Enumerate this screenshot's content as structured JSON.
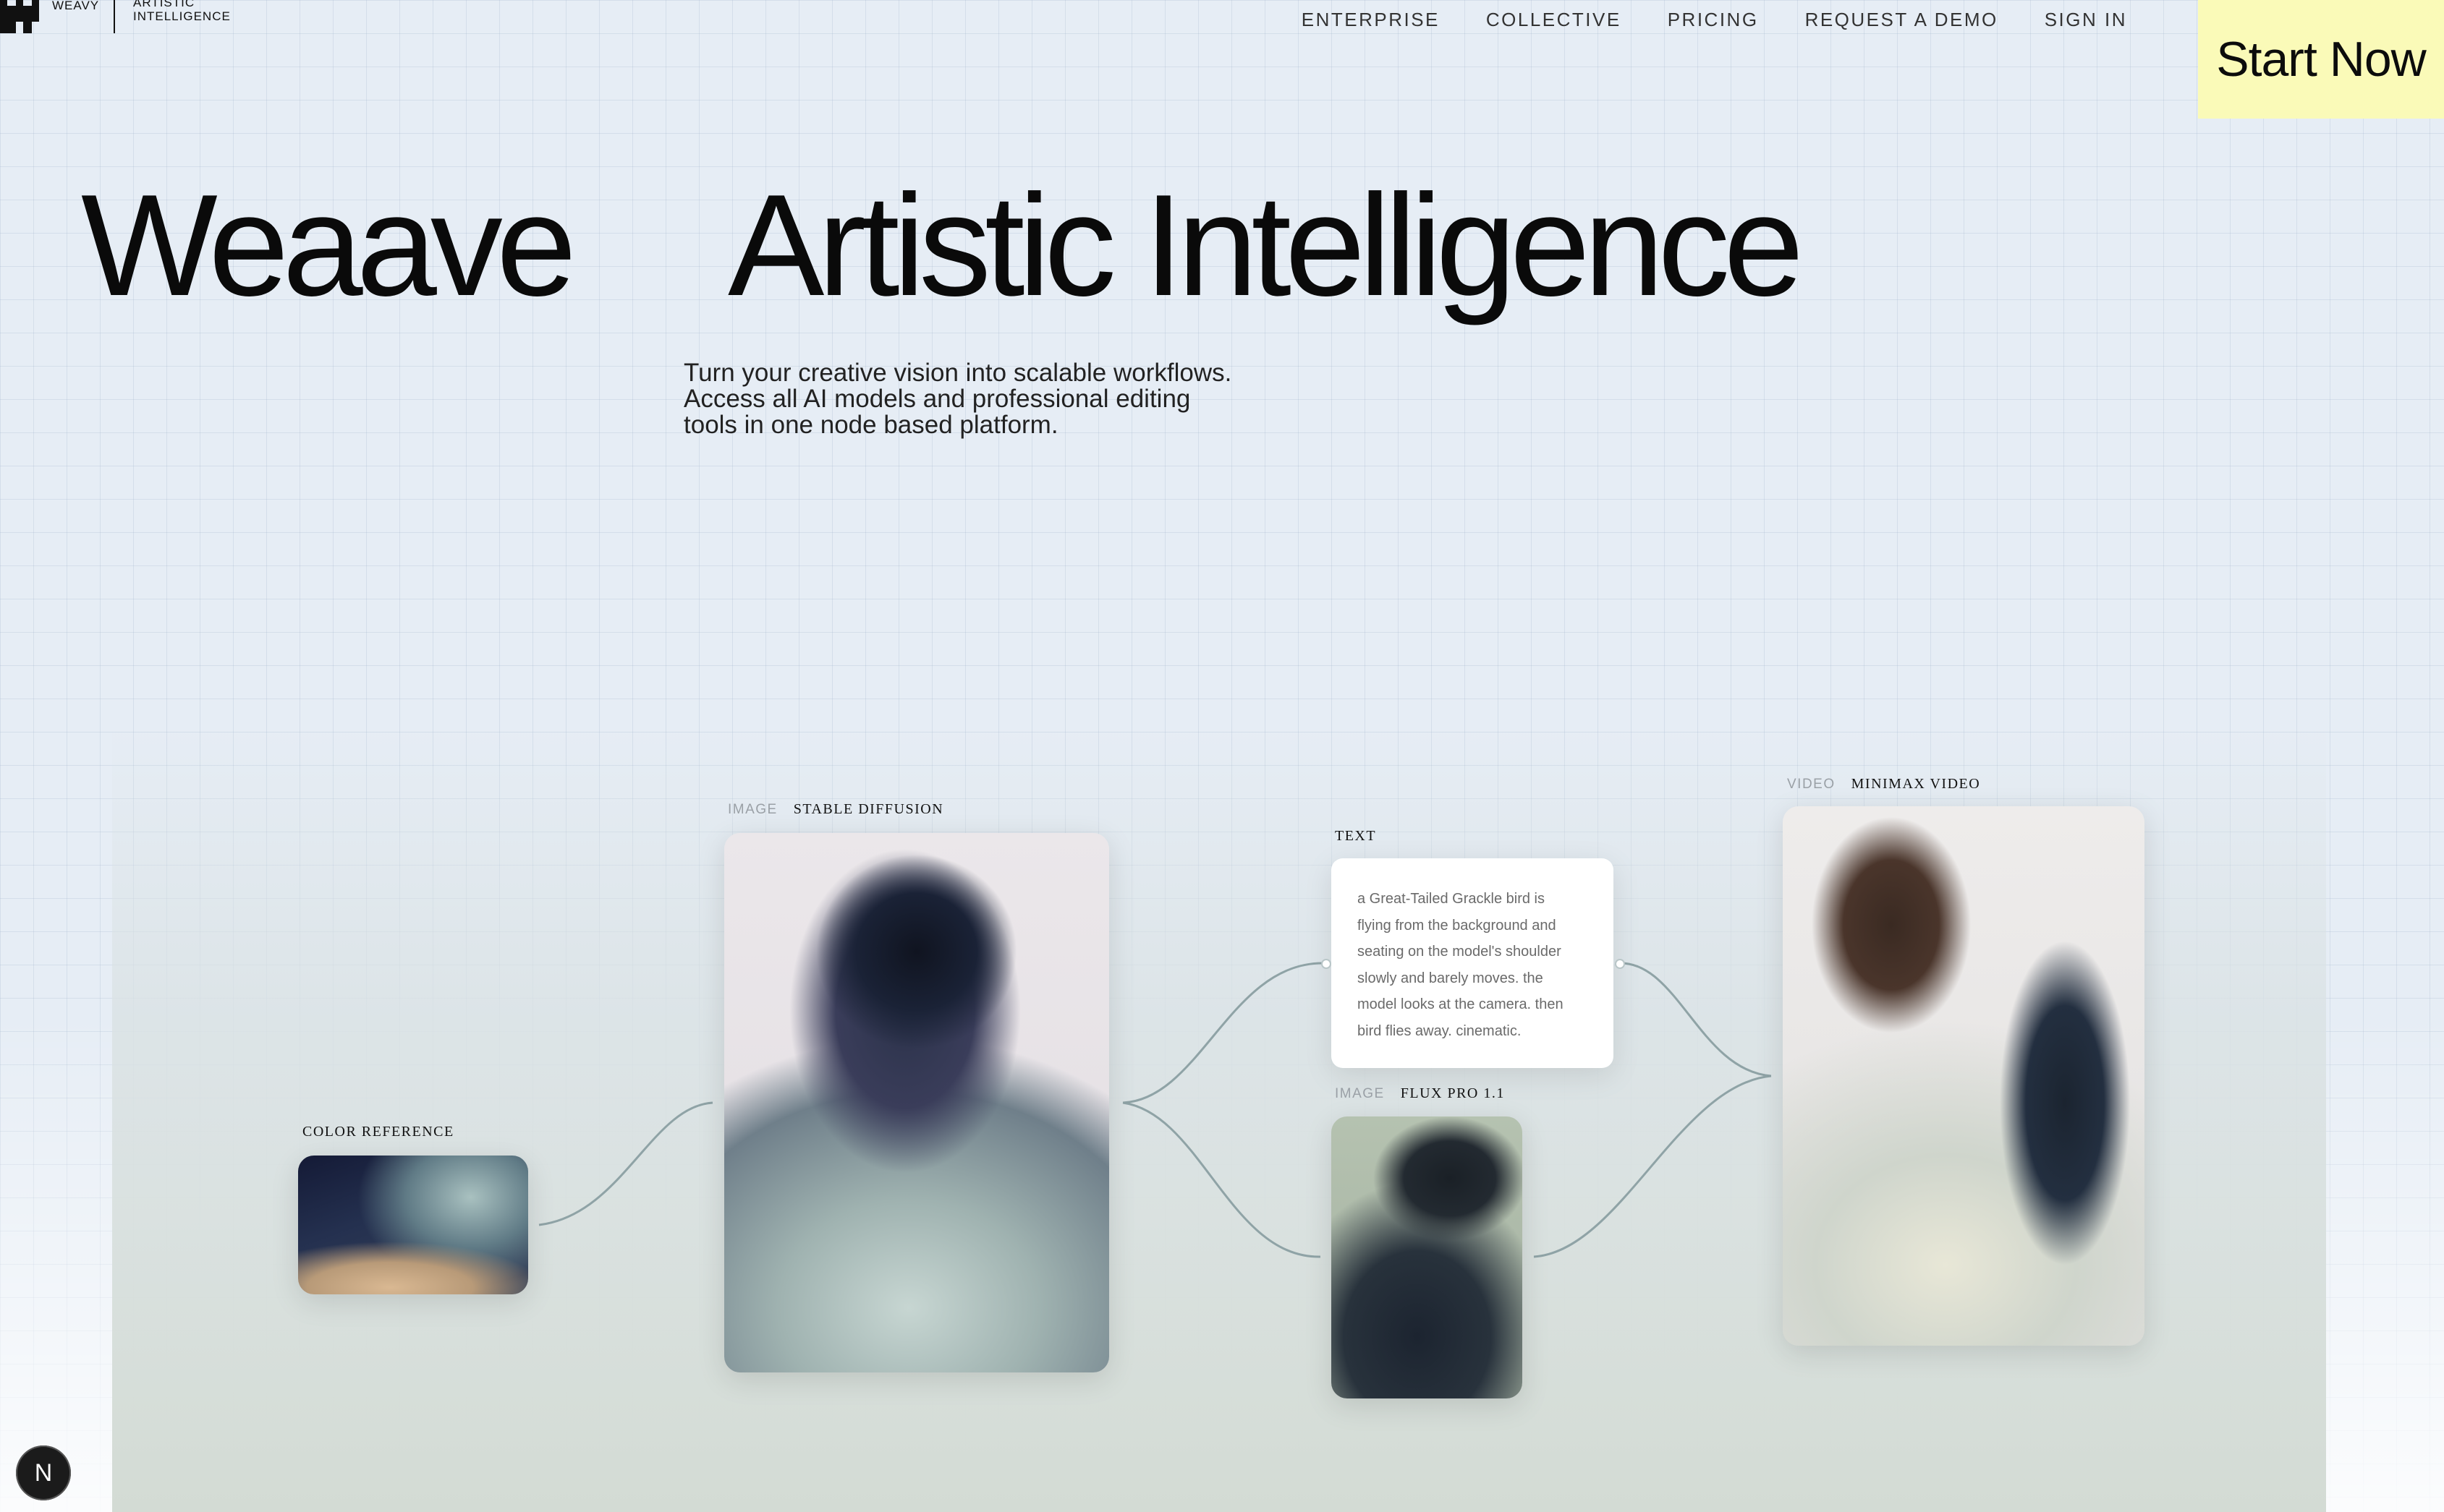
{
  "brand": {
    "name": "WEAVY",
    "tagline": "ARTISTIC INTELLIGENCE"
  },
  "nav": {
    "items": [
      "ENTERPRISE",
      "COLLECTIVE",
      "PRICING",
      "REQUEST A DEMO",
      "SIGN IN"
    ],
    "cta": "Start Now"
  },
  "hero": {
    "title_left": "Weaave",
    "title_right": "Artistic Intelligence",
    "subtitle_lines": [
      "Turn your creative vision into scalable workflows.",
      "Access all AI models and professional editing",
      "tools in one node based platform."
    ]
  },
  "nodes": {
    "color_reference": {
      "label": "COLOR REFERENCE"
    },
    "stable_diffusion": {
      "kind": "IMAGE",
      "label": "STABLE DIFFUSION"
    },
    "text": {
      "label": "TEXT",
      "lines": [
        "a Great-Tailed Grackle bird is",
        "flying from the background and",
        "seating on the model's shoulder",
        "slowly and barely moves. the",
        "model looks at the camera. then",
        "bird flies away. cinematic."
      ]
    },
    "flux": {
      "kind": "IMAGE",
      "label": "FLUX PRO 1.1"
    },
    "video": {
      "kind": "VIDEO",
      "label": "MINIMAX VIDEO"
    }
  },
  "badge": {
    "letter": "N",
    "icon": "nextjs-icon"
  },
  "colors": {
    "cta_bg": "#fafab8",
    "page_bg": "#e6edf5",
    "wire": "#8fa3a6"
  }
}
